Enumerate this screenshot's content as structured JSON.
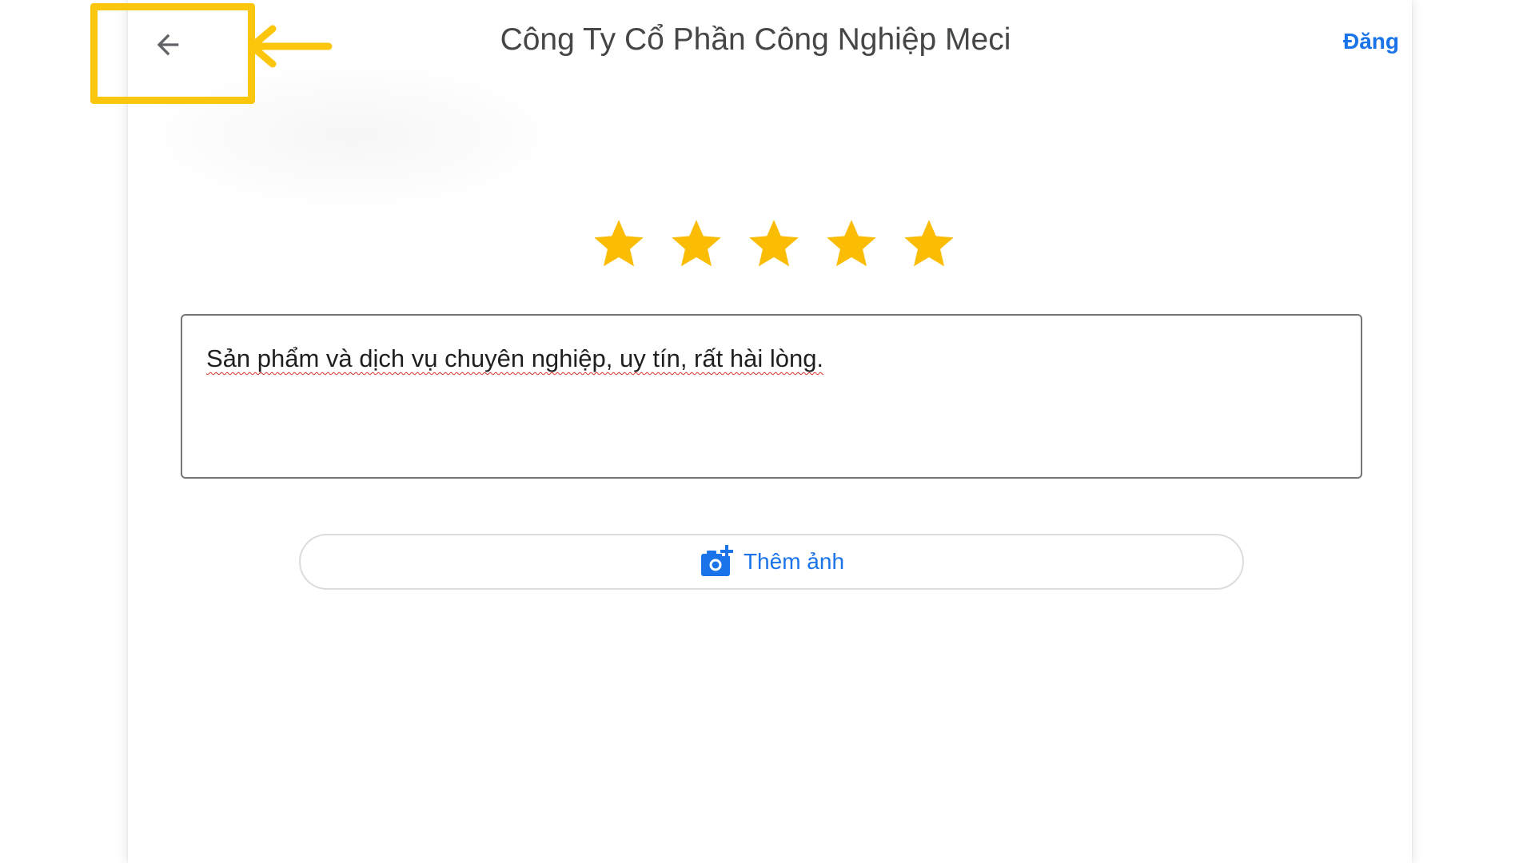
{
  "header": {
    "title": "Công Ty Cổ Phần Công Nghiệp Meci",
    "post_label": "Đăng",
    "back_icon": "arrow-left-icon"
  },
  "annotation": {
    "highlight_color": "#fbc60b",
    "pointer_icon": "arrow-left-icon"
  },
  "rating": {
    "value": 5,
    "max": 5,
    "star_color": "#fbbc04",
    "star_icon": "star-icon"
  },
  "review": {
    "text": "Sản phẩm và dịch vụ chuyên nghiệp, uy tín, rất hài lòng."
  },
  "add_photo": {
    "label": "Thêm ảnh",
    "icon": "add-photo-camera-icon"
  },
  "colors": {
    "accent": "#1a73e8",
    "title_text": "#444746",
    "border": "#747775",
    "spellcheck_underline": "#d93025"
  }
}
